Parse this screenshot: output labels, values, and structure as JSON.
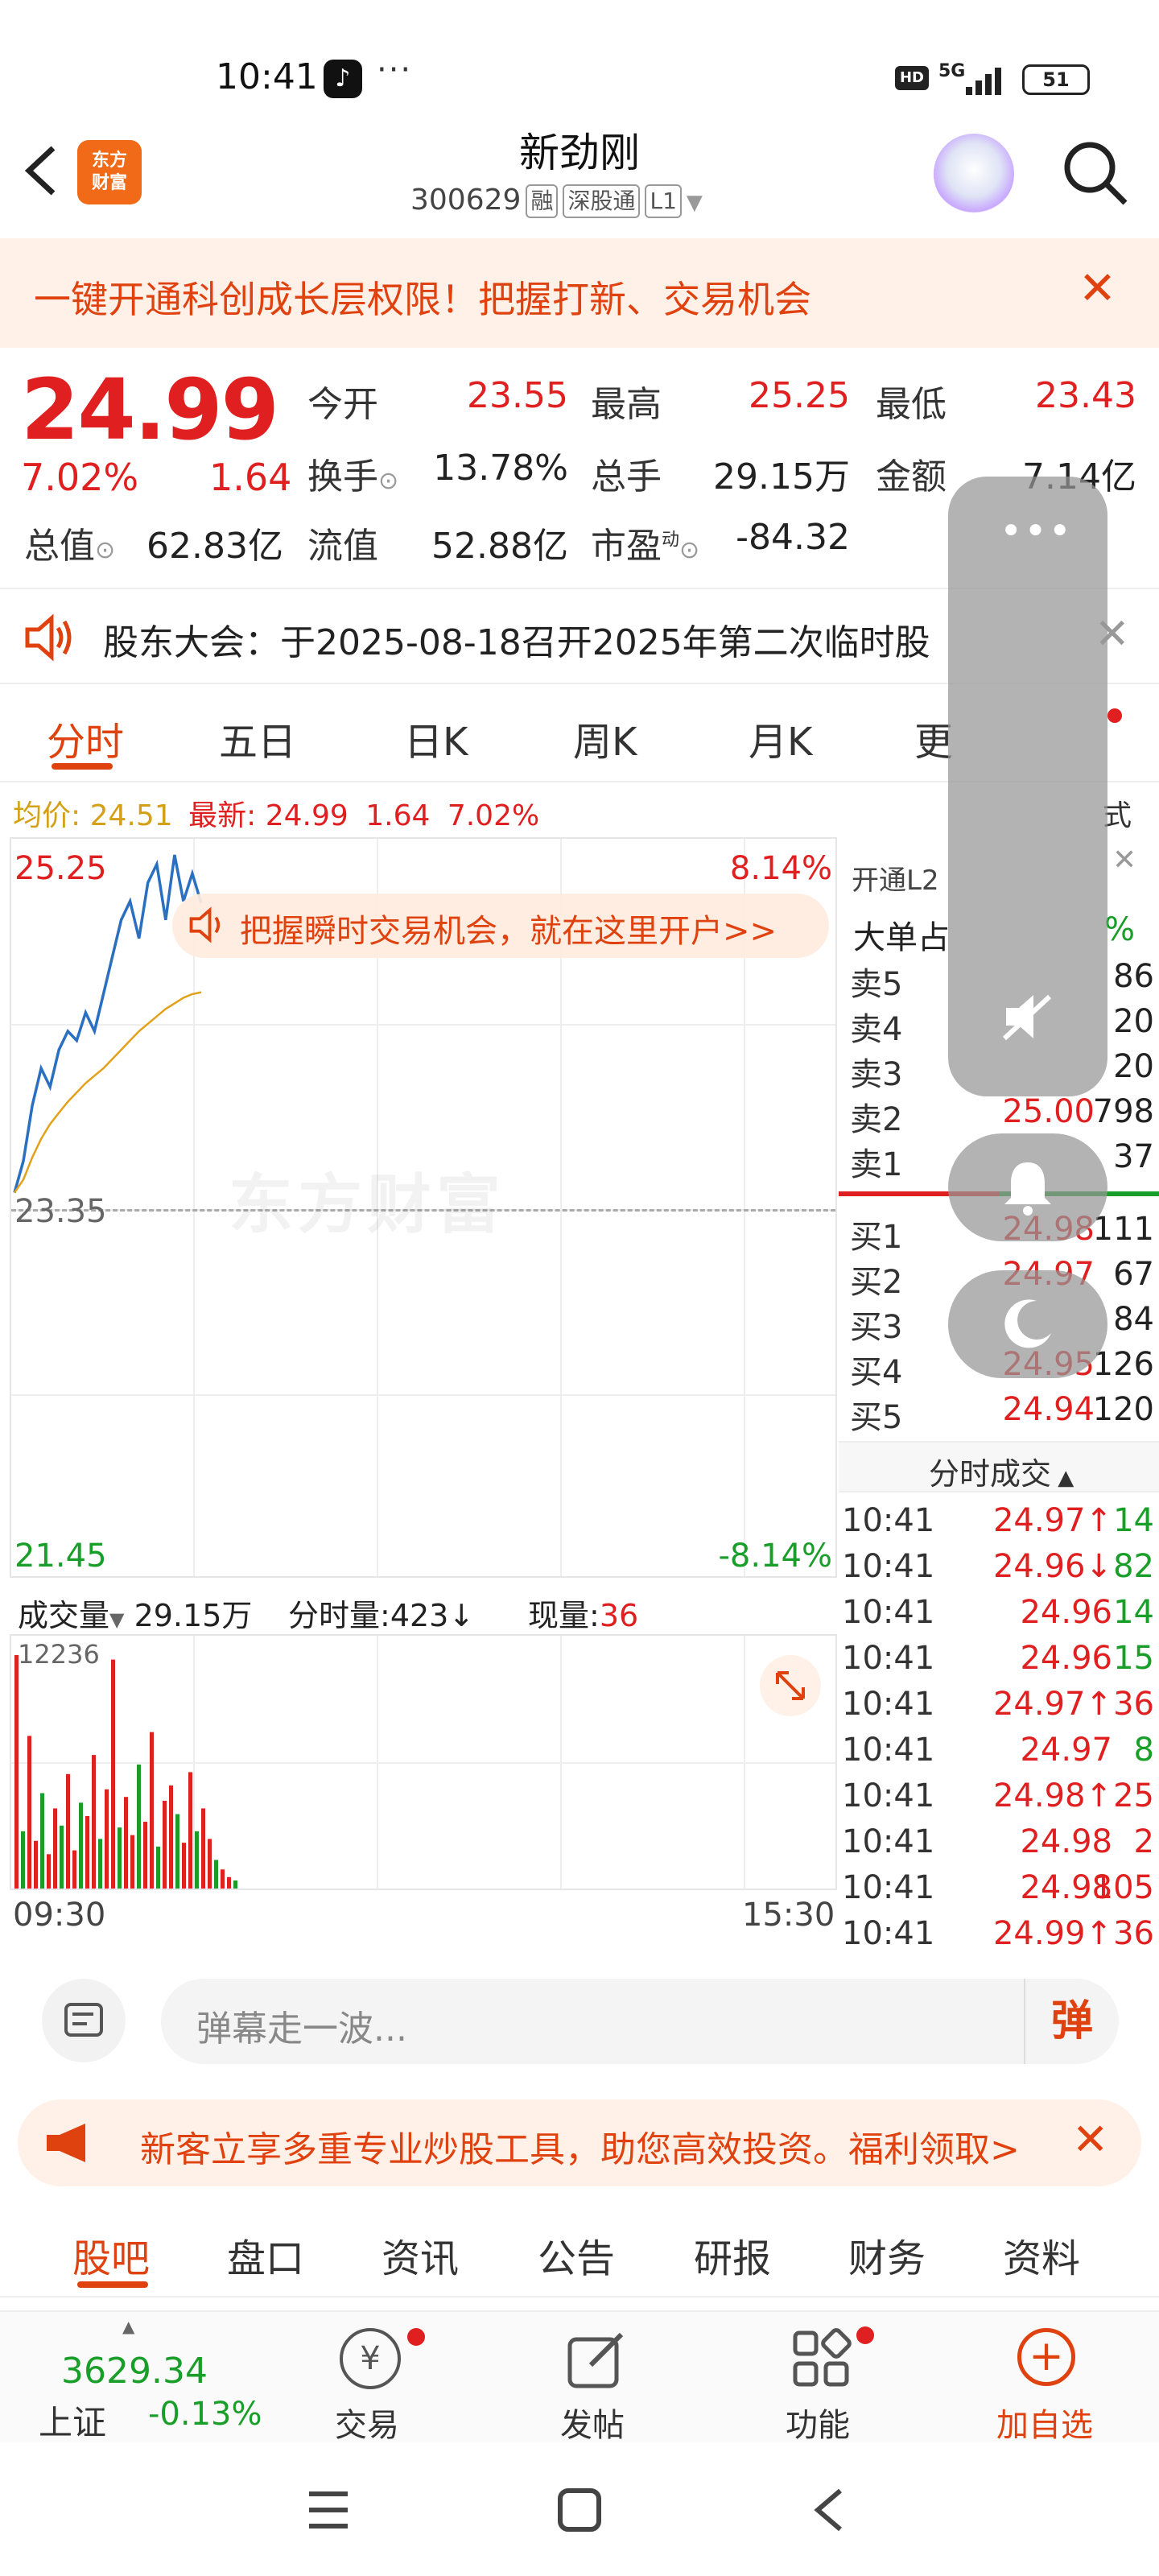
{
  "status_bar": {
    "time": "10:41",
    "dots": "···",
    "hd": "HD",
    "network": "5G",
    "battery": "51"
  },
  "header": {
    "logo_line1": "东方",
    "logo_line2": "财富",
    "stock_name": "新劲刚",
    "stock_code": "300629",
    "tags": [
      "融",
      "深股通",
      "L1"
    ]
  },
  "promo_banner": {
    "text": "一键开通科创成长层权限！把握打新、交易机会",
    "close": "✕"
  },
  "quote": {
    "price": "24.99",
    "change_pct": "7.02%",
    "change": "1.64",
    "open_label": "今开",
    "open": "23.55",
    "high_label": "最高",
    "high": "25.25",
    "low_label": "最低",
    "low": "23.43",
    "turnover_label": "换手",
    "turnover": "13.78%",
    "volume_label": "总手",
    "volume": "29.15万",
    "amount_label": "金额",
    "amount": "7.14亿",
    "mktcap_label": "总值",
    "mktcap": "62.83亿",
    "float_label": "流值",
    "float": "52.88亿",
    "pe_label": "市盈",
    "pe_sup": "动",
    "pe": "-84.32"
  },
  "notice": {
    "text": "股东大会：于2025-08-18召开2025年第二次临时股",
    "close": "✕"
  },
  "tabs": [
    "分时",
    "五日",
    "日K",
    "周K",
    "月K",
    "更"
  ],
  "avg_bar": {
    "avg_label": "均价:",
    "avg": "24.51",
    "latest_label": "最新:",
    "latest": "24.99",
    "chg": "1.64",
    "pct": "7.02%",
    "mode": "式"
  },
  "chart": {
    "y_top": "25.25",
    "y_mid": "23.35",
    "y_bottom": "21.45",
    "pct_top": "8.14%",
    "pct_bottom": "-8.14%",
    "hint": "把握瞬时交易机会，就在这里开户>>",
    "watermark": "东方财富",
    "vol_label": "成交量",
    "vol_total": "29.15万",
    "vol_min_label": "分时量:",
    "vol_min": "423",
    "vol_now_label": "现量:",
    "vol_now": "36",
    "vol_max": "12236",
    "time_start": "09:30",
    "time_end": "15:30"
  },
  "chart_data": {
    "type": "line",
    "title": "",
    "ylim": [
      21.45,
      25.25
    ],
    "series": [
      {
        "name": "",
        "values": [
          23.43,
          23.6,
          23.9,
          24.1,
          24.0,
          24.2,
          24.3,
          24.25,
          24.4,
          24.3,
          24.5,
          24.7,
          24.9,
          25.0,
          24.8,
          25.1,
          25.2,
          24.9,
          25.25,
          25.0,
          25.15,
          24.99
        ]
      },
      {
        "name": "",
        "values": [
          23.43,
          23.5,
          23.62,
          23.72,
          23.8,
          23.86,
          23.92,
          23.97,
          24.02,
          24.06,
          24.1,
          24.15,
          24.2,
          24.25,
          24.3,
          24.34,
          24.38,
          24.42,
          24.45,
          24.48,
          24.5,
          24.51
        ]
      }
    ],
    "volume": [
      12236,
      3000,
      8000,
      2500,
      5000,
      1800,
      4200,
      3300,
      6000,
      2000,
      4500,
      3800,
      7000,
      2600,
      5200,
      12000,
      3200,
      4800,
      2800,
      6500,
      3500,
      8200,
      2200,
      4600,
      5400,
      3900,
      2400,
      6100,
      3000,
      4200,
      2600,
      1500,
      1000,
      600,
      423
    ]
  },
  "order_book": {
    "l2_label": "开通L2",
    "big_label": "大单占",
    "big_pct": "%",
    "asks": [
      {
        "label": "卖5",
        "price": "",
        "vol": "86"
      },
      {
        "label": "卖4",
        "price": "",
        "vol": "20"
      },
      {
        "label": "卖3",
        "price": "",
        "vol": "20"
      },
      {
        "label": "卖2",
        "price": "25.00",
        "vol": "798"
      },
      {
        "label": "卖1",
        "price": "",
        "vol": "37"
      }
    ],
    "bids": [
      {
        "label": "买1",
        "price": "24.98",
        "vol": "111"
      },
      {
        "label": "买2",
        "price": "24.97",
        "vol": "67"
      },
      {
        "label": "买3",
        "price": "",
        "vol": "84"
      },
      {
        "label": "买4",
        "price": "24.95",
        "vol": "126"
      },
      {
        "label": "买5",
        "price": "24.94",
        "vol": "120"
      }
    ],
    "trades_label": "分时成交",
    "trades": [
      {
        "time": "10:41",
        "price": "24.97↑",
        "vol": "14",
        "color": "#1a9e2a"
      },
      {
        "time": "10:41",
        "price": "24.96↓",
        "vol": "82",
        "color": "#1a9e2a"
      },
      {
        "time": "10:41",
        "price": "24.96",
        "vol": "14",
        "color": "#1a9e2a"
      },
      {
        "time": "10:41",
        "price": "24.96",
        "vol": "15",
        "color": "#1a9e2a"
      },
      {
        "time": "10:41",
        "price": "24.97↑",
        "vol": "36",
        "color": "#e02020"
      },
      {
        "time": "10:41",
        "price": "24.97",
        "vol": "8",
        "color": "#1a9e2a"
      },
      {
        "time": "10:41",
        "price": "24.98↑",
        "vol": "25",
        "color": "#e02020"
      },
      {
        "time": "10:41",
        "price": "24.98",
        "vol": "2",
        "color": "#e02020"
      },
      {
        "time": "10:41",
        "price": "24.98",
        "vol": "105",
        "color": "#e02020"
      },
      {
        "time": "10:41",
        "price": "24.99↑",
        "vol": "36",
        "color": "#e02020"
      }
    ]
  },
  "danmu": {
    "placeholder": "弹幕走一波...",
    "button": "弹"
  },
  "promo2": {
    "text": "新客立享多重专业炒股工具，助您高效投资。福利领取>"
  },
  "subtabs": [
    "股吧",
    "盘口",
    "资讯",
    "公告",
    "研报",
    "财务",
    "资料"
  ],
  "bottom_nav": {
    "index_value": "3629.34",
    "index_name": "上证",
    "index_pct": "-0.13%",
    "items": [
      "交易",
      "发帖",
      "功能",
      "加自选"
    ]
  },
  "colors": {
    "up": "#e02020",
    "down": "#1a9e2a",
    "brand": "#f06a18",
    "accent": "#e0420f"
  }
}
